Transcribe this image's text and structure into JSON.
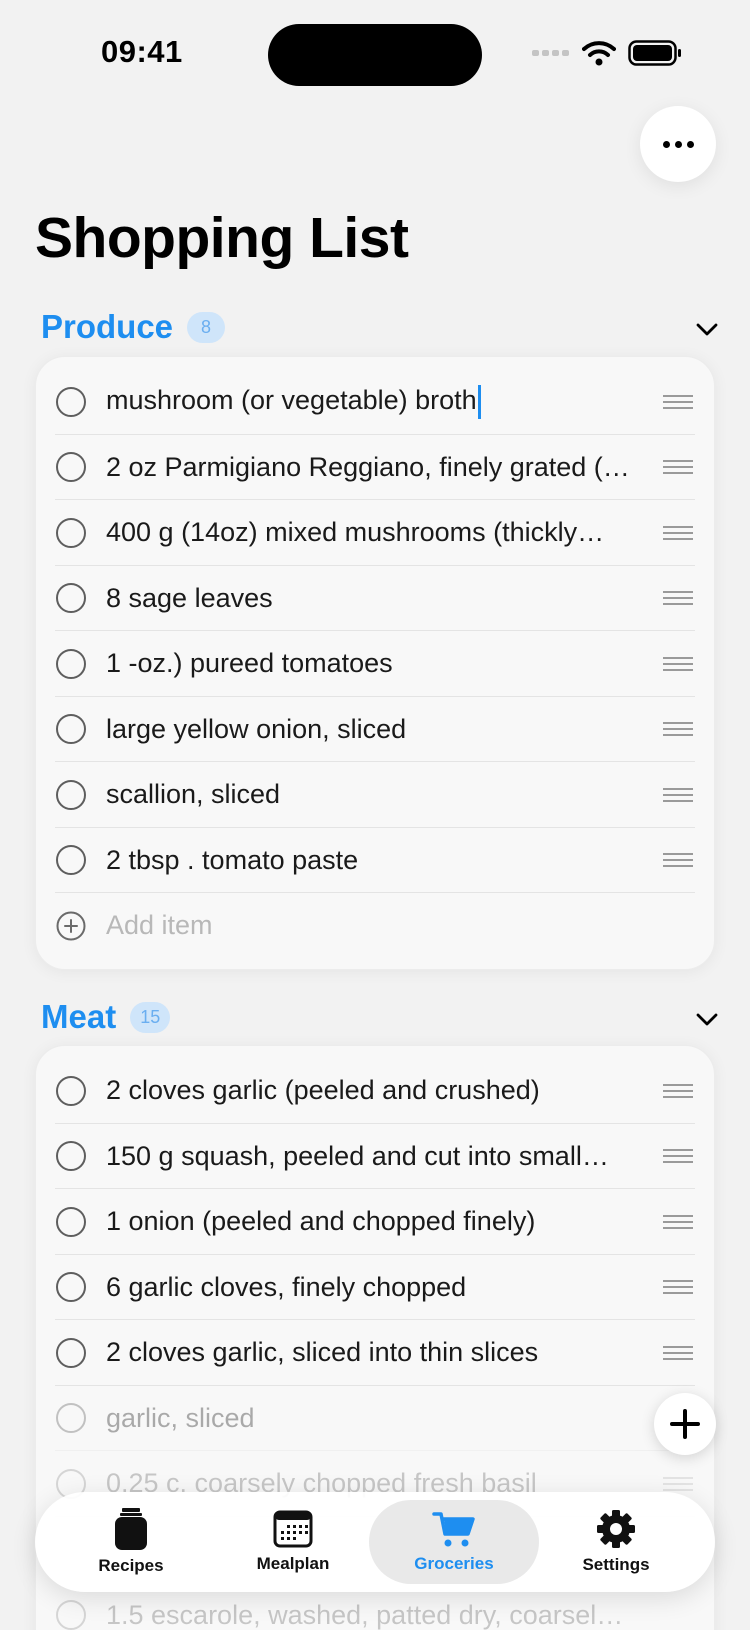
{
  "status": {
    "time": "09:41"
  },
  "header": {
    "title": "Shopping List"
  },
  "sections": [
    {
      "title": "Produce",
      "count": "8",
      "items": [
        "mushroom (or vegetable) broth",
        "2 oz Parmigiano Reggiano, finely grated (…",
        "400 g (14oz) mixed mushrooms (thickly…",
        "8 sage leaves",
        "1 -oz.) pureed tomatoes",
        "large yellow onion, sliced",
        "scallion, sliced",
        "2 tbsp . tomato paste"
      ],
      "add_placeholder": "Add item"
    },
    {
      "title": "Meat",
      "count": "15",
      "items": [
        "2 cloves garlic (peeled and crushed)",
        "150 g squash, peeled and cut into small…",
        "1 onion (peeled and chopped finely)",
        "6 garlic cloves, finely chopped",
        "2 cloves garlic, sliced into thin slices",
        "garlic, sliced",
        "0.25 c. coarsely chopped fresh basil",
        "1.5 escarole, washed, patted dry, coarsel…"
      ]
    }
  ],
  "tabs": [
    {
      "label": "Recipes",
      "icon": "jar-icon"
    },
    {
      "label": "Mealplan",
      "icon": "calendar-icon"
    },
    {
      "label": "Groceries",
      "icon": "cart-icon",
      "active": true
    },
    {
      "label": "Settings",
      "icon": "gear-icon"
    }
  ],
  "colors": {
    "accent": "#1e8ef0",
    "background": "#f2f2f2"
  }
}
